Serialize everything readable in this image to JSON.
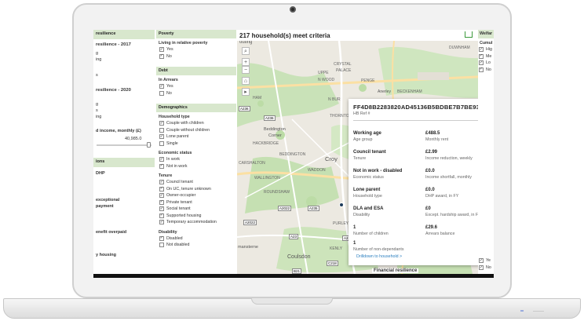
{
  "map_title": "217 household(s) meet criteria",
  "left_column": {
    "header": "resilience",
    "sections": [
      {
        "label": "resilience - 2017"
      },
      {
        "label": "resilience - 2020"
      }
    ],
    "row_fragments": [
      "g",
      "ing",
      "s",
      "g",
      "s",
      "ing"
    ],
    "income_label": "d income, monthly (£)",
    "income_value": "40,985.0",
    "header2": "ions",
    "items": [
      "DHP",
      "exceptional",
      "payment",
      "enefit overpaid",
      "y housing"
    ]
  },
  "filters": {
    "poverty": {
      "header": "Poverty",
      "title": "Living in relative poverty",
      "options": [
        {
          "label": "Yes",
          "checked": true
        },
        {
          "label": "No",
          "checked": true
        }
      ]
    },
    "debt": {
      "header": "Debt",
      "title": "In Arrears",
      "options": [
        {
          "label": "Yes",
          "checked": true
        },
        {
          "label": "No",
          "checked": false
        }
      ]
    },
    "demographics": {
      "header": "Demographics",
      "household_title": "Household type",
      "household": [
        {
          "label": "Couple with children",
          "checked": true
        },
        {
          "label": "Couple without children",
          "checked": false
        },
        {
          "label": "Lone parent",
          "checked": true
        },
        {
          "label": "Single",
          "checked": false
        }
      ],
      "economic_title": "Economic status",
      "economic": [
        {
          "label": "In work",
          "checked": true
        },
        {
          "label": "Not in work",
          "checked": true
        }
      ],
      "tenure_title": "Tenure",
      "tenure": [
        {
          "label": "Council tenant",
          "checked": true
        },
        {
          "label": "On UC, tenure unknown",
          "checked": true
        },
        {
          "label": "Owner-occupier",
          "checked": true
        },
        {
          "label": "Private tenant",
          "checked": true
        },
        {
          "label": "Social tenant",
          "checked": true
        },
        {
          "label": "Supported housing",
          "checked": true
        },
        {
          "label": "Temporary accommodation",
          "checked": true
        }
      ],
      "disability_title": "Disability",
      "disability": [
        {
          "label": "Disabled",
          "checked": true
        },
        {
          "label": "Not disabled",
          "checked": false
        }
      ]
    }
  },
  "map": {
    "zoom_in": "+",
    "zoom_out": "−",
    "labels": [
      "UPPE",
      "CRYSTAL",
      "PALACE",
      "N WOOD",
      "PENGE",
      "Anerley",
      "BECKENHAM",
      "DUWNHAM",
      "HAM",
      "THORNTON",
      "Beddington",
      "Corner",
      "HACKBRIDGE",
      "CARSHALTON",
      "WALLINGTON",
      "ROUNDSHAW",
      "PURLEY",
      "KENLY",
      "Coulsdon",
      "mansterne",
      "Croy",
      "WADDON",
      "BEDDINGTON",
      "N BUR",
      "outing"
    ],
    "roads": [
      "A236",
      "A2022",
      "A235",
      "A23",
      "A2022",
      "A22",
      "B21",
      "C218"
    ],
    "bottom_text": "Financial resilience"
  },
  "card": {
    "household_id": "FF4D8B2283820AD45136B5BDBE7B7BE93C9",
    "household_id_label": "HB Ref #",
    "fields": [
      {
        "value": "Working age",
        "label": "Age group"
      },
      {
        "value": "£488.5",
        "label": "Monthly rent"
      },
      {
        "value": "Council tenant",
        "label": "Tenure"
      },
      {
        "value": "£2.99",
        "label": "Income reduction, weekly"
      },
      {
        "value": "Not in work - disabled",
        "label": "Economic status"
      },
      {
        "value": "£0.0",
        "label": "Income shortfall, monthly"
      },
      {
        "value": "Lone parent",
        "label": "Household type"
      },
      {
        "value": "£0.0",
        "label": "DHP award, in FY"
      },
      {
        "value": "DLA and ESA",
        "label": "Disability"
      },
      {
        "value": "£0",
        "label": "Except. hardship award, in FY"
      },
      {
        "value": "1",
        "label": "Number of children"
      },
      {
        "value": "£29.6",
        "label": "Arrears balance"
      },
      {
        "value": "1",
        "label": "Number of non-dependants"
      }
    ],
    "drilldown": "Drilldown to household >"
  },
  "right_column": {
    "header": "Welfar",
    "title": "Cumul",
    "items": [
      "Hig",
      "Me",
      "Lo",
      "No"
    ],
    "bottom_items": [
      "Ye",
      "No"
    ]
  },
  "colors": {
    "section_header": "#d8e7cd",
    "accent_green": "#3b9a3b",
    "link_blue": "#2b7fbf"
  }
}
